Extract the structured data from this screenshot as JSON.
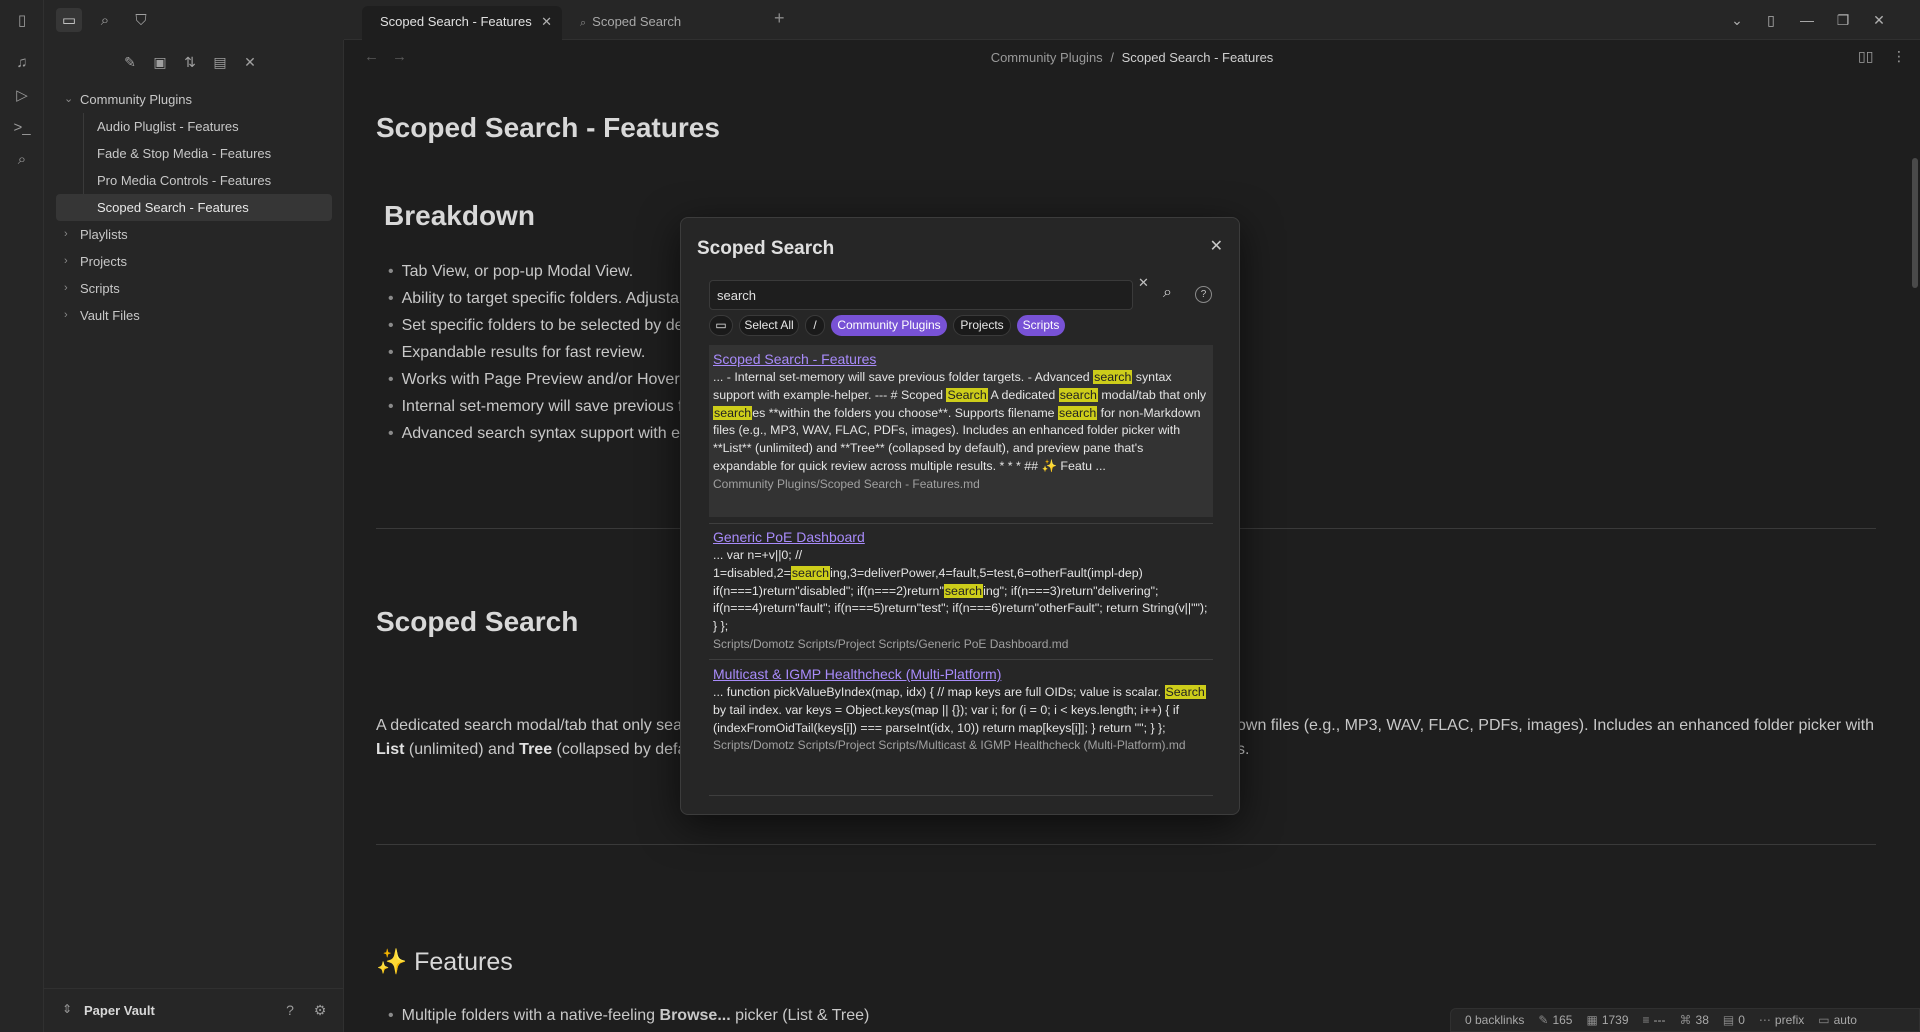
{
  "app": {
    "vault_name": "Paper Vault"
  },
  "tabs": [
    {
      "label": "Scoped Search - Features",
      "active": true
    },
    {
      "label": "Scoped Search",
      "active": false
    }
  ],
  "sidebar": {
    "tree": [
      {
        "label": "Community Plugins",
        "level": 0,
        "expanded": true
      },
      {
        "label": "Audio Pluglist - Features",
        "level": 1
      },
      {
        "label": "Fade & Stop Media - Features",
        "level": 1
      },
      {
        "label": "Pro Media Controls - Features",
        "level": 1
      },
      {
        "label": "Scoped Search - Features",
        "level": 1,
        "selected": true
      },
      {
        "label": "Playlists",
        "level": 0,
        "expanded": false
      },
      {
        "label": "Projects",
        "level": 0,
        "expanded": false
      },
      {
        "label": "Scripts",
        "level": 0,
        "expanded": false
      },
      {
        "label": "Vault Files",
        "level": 0,
        "expanded": false
      }
    ]
  },
  "breadcrumb": {
    "parent": "Community Plugins",
    "separator": "/",
    "current": "Scoped Search - Features"
  },
  "document": {
    "title": "Scoped Search - Features",
    "h_breakdown": "Breakdown",
    "breakdown_bullets": [
      "Tab View, or pop-up Modal View.",
      "Ability to target specific folders. Adjusta",
      "Set specific folders to be selected by def",
      "Expandable results for fast review.",
      "Works with Page Preview and/or Hover E",
      "Internal set-memory will save previous f",
      "Advanced search syntax support with ex"
    ],
    "h_scoped": "Scoped Search",
    "para_line1_left": "A dedicated search modal/tab that only sea",
    "para_line1_right": "own files (e.g., MP3, WAV, FLAC, PDFs, images). Includes an enhanced folder picker with",
    "para_line2_b1": "List",
    "para_line2_t1": " (unlimited) and ",
    "para_line2_b2": "Tree",
    "para_line2_t2": " (collapsed by defa",
    "para_line2_right": "s.",
    "h_features_icon": "✨",
    "h_features": "Features",
    "features_bullet_t1": "Multiple folders with a native-feeling ",
    "features_bullet_b": "Browse...",
    "features_bullet_t2": " picker (List & Tree)"
  },
  "modal": {
    "title": "Scoped Search",
    "search_value": "search",
    "chips": [
      {
        "label": "Select All",
        "on": false
      },
      {
        "label": "/",
        "on": false
      },
      {
        "label": "Community Plugins",
        "on": true
      },
      {
        "label": "Projects",
        "on": false
      },
      {
        "label": "Scripts",
        "on": true
      }
    ],
    "help_label": "?",
    "results": [
      {
        "title": "Scoped Search - Features",
        "path": "Community Plugins/Scoped Search - Features.md"
      },
      {
        "title": "Generic PoE Dashboard",
        "path": "Scripts/Domotz Scripts/Project Scripts/Generic PoE Dashboard.md"
      },
      {
        "title": "Multicast & IGMP Healthcheck (Multi-Platform)",
        "path": "Scripts/Domotz Scripts/Project Scripts/Multicast & IGMP Healthcheck (Multi-Platform).md"
      }
    ]
  },
  "statusbar": {
    "backlinks": "0 backlinks",
    "words": "165",
    "chars": "1739",
    "reading": "---",
    "links": "38",
    "zero": "0",
    "prefix": "prefix",
    "auto": "auto"
  },
  "colors": {
    "accent": "#7852d6",
    "link": "#a88bfa",
    "highlight": "#cdcd1a",
    "background": "#1e1e1e",
    "panel": "#262626"
  }
}
